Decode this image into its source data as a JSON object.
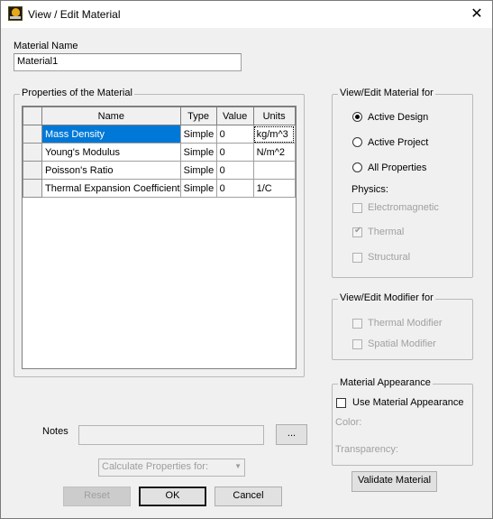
{
  "window": {
    "title": "View / Edit Material",
    "close_glyph": "✕",
    "app_icon": "app-logo-icon"
  },
  "material_name": {
    "label": "Material Name",
    "value": "Material1"
  },
  "properties": {
    "group_title": "Properties of the Material",
    "columns": [
      "Name",
      "Type",
      "Value",
      "Units"
    ],
    "rows": [
      {
        "name": "Mass Density",
        "type": "Simple",
        "value": "0",
        "units": "kg/m^3",
        "selected": true
      },
      {
        "name": "Young's Modulus",
        "type": "Simple",
        "value": "0",
        "units": "N/m^2",
        "selected": false
      },
      {
        "name": "Poisson's Ratio",
        "type": "Simple",
        "value": "0",
        "units": "",
        "selected": false
      },
      {
        "name": "Thermal Expansion Coefficient",
        "type": "Simple",
        "value": "0",
        "units": "1/C",
        "selected": false
      }
    ]
  },
  "view_edit_for": {
    "group_title": "View/Edit Material for",
    "options": [
      {
        "label": "Active Design",
        "checked": true
      },
      {
        "label": "Active Project",
        "checked": false
      },
      {
        "label": "All Properties",
        "checked": false
      }
    ],
    "physics_label": "Physics:",
    "physics": [
      {
        "label": "Electromagnetic",
        "checked": false
      },
      {
        "label": "Thermal",
        "checked": true
      },
      {
        "label": "Structural",
        "checked": false
      }
    ]
  },
  "modifier": {
    "group_title": "View/Edit Modifier for",
    "options": [
      {
        "label": "Thermal Modifier",
        "checked": false
      },
      {
        "label": "Spatial Modifier",
        "checked": false
      }
    ]
  },
  "appearance": {
    "group_title": "Material Appearance",
    "use_label": "Use Material Appearance",
    "color_label": "Color:",
    "transparency_label": "Transparency:"
  },
  "notes": {
    "label": "Notes",
    "value": "",
    "browse_label": "..."
  },
  "calculate": {
    "selected": "Calculate Properties for:"
  },
  "buttons": {
    "reset": "Reset",
    "ok": "OK",
    "cancel": "Cancel",
    "validate": "Validate Material"
  }
}
